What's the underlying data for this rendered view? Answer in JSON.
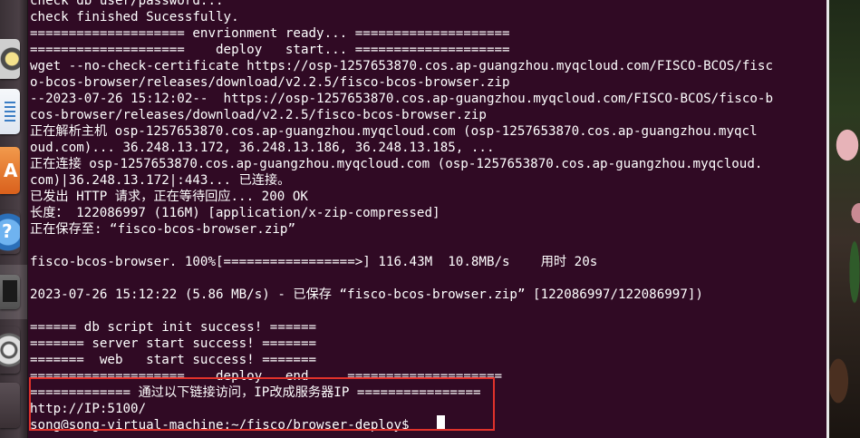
{
  "launcher": {
    "icons": [
      "speaker-icon",
      "writer-icon",
      "software-center-icon",
      "help-icon",
      "system-monitor-icon",
      "software-updater-icon",
      "app-icon"
    ]
  },
  "terminal": {
    "lines": [
      "check db user/password...",
      "check finished Sucessfully.",
      "==================== envrionment ready... ====================",
      "====================    deploy   start... ====================",
      "wget --no-check-certificate https://osp-1257653870.cos.ap-guangzhou.myqcloud.com/FISCO-BCOS/fisc",
      "o-bcos-browser/releases/download/v2.2.5/fisco-bcos-browser.zip",
      "--2023-07-26 15:12:02--  https://osp-1257653870.cos.ap-guangzhou.myqcloud.com/FISCO-BCOS/fisco-b",
      "cos-browser/releases/download/v2.2.5/fisco-bcos-browser.zip",
      "正在解析主机 osp-1257653870.cos.ap-guangzhou.myqcloud.com (osp-1257653870.cos.ap-guangzhou.myqcl",
      "oud.com)... 36.248.13.172, 36.248.13.186, 36.248.13.185, ...",
      "正在连接 osp-1257653870.cos.ap-guangzhou.myqcloud.com (osp-1257653870.cos.ap-guangzhou.myqcloud.",
      "com)|36.248.13.172|:443... 已连接。",
      "已发出 HTTP 请求，正在等待回应... 200 OK",
      "长度： 122086997 (116M) [application/x-zip-compressed]",
      "正在保存至: “fisco-bcos-browser.zip”",
      "",
      "fisco-bcos-browser. 100%[=================>] 116.43M  10.8MB/s    用时 20s",
      "",
      "2023-07-26 15:12:22 (5.86 MB/s) - 已保存 “fisco-bcos-browser.zip” [122086997/122086997])",
      "",
      "====== db script init success! ======",
      "======= server start success! =======",
      "=======  web   start success! =======",
      "====================    deploy   end     ====================",
      "============= 通过以下链接访问，IP改成服务器IP ================",
      "http://IP:5100/",
      "song@song-virtual-machine:~/fisco/browser-deploy$ "
    ]
  },
  "colors": {
    "terminal_bg": "#300a24",
    "text": "#ffffff",
    "highlight_border": "#e0322b"
  }
}
